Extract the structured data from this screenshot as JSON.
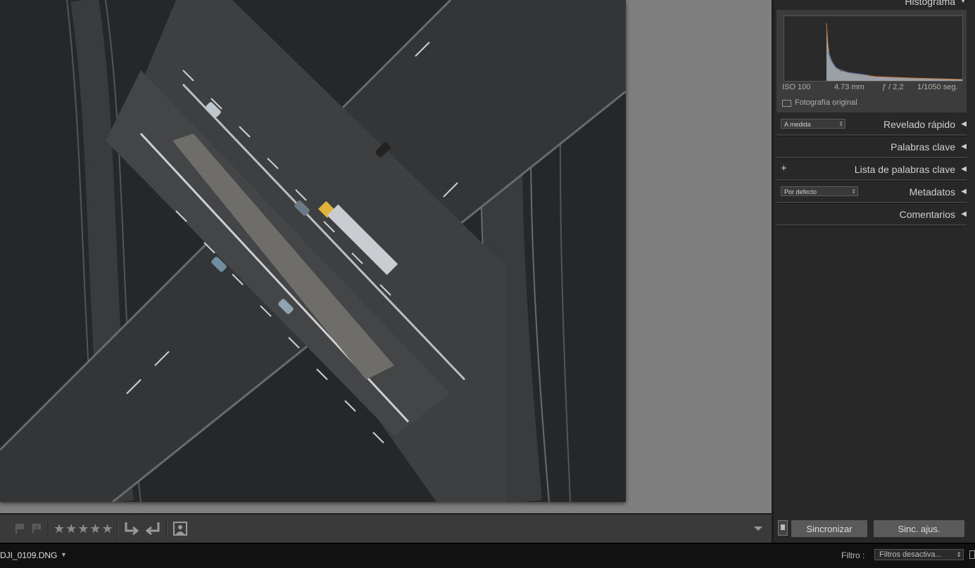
{
  "histogram": {
    "title": "Histograma",
    "iso": "ISO 100",
    "focal": "4.73 mm",
    "aperture": "ƒ / 2,2",
    "shutter": "1/1050 seg.",
    "original_label": "Fotografía original"
  },
  "panels": {
    "quick_develop": {
      "title": "Revelado rápido",
      "preset": "A medida"
    },
    "keywords": {
      "title": "Palabras clave"
    },
    "keyword_list": {
      "title": "Lista de palabras clave",
      "add_symbol": "+"
    },
    "metadata": {
      "title": "Metadatos",
      "preset": "Por defecto"
    },
    "comments": {
      "title": "Comentarios"
    }
  },
  "sync": {
    "sync_label": "Sincronizar",
    "sync_settings_label": "Sinc. ajus."
  },
  "toolbar": {
    "stars": "★★★★★"
  },
  "filmstrip": {
    "filename": "DJI_0109.DNG",
    "filter_label": "Filtro :",
    "filter_value": "Filtros desactiva..."
  },
  "colors": {
    "viewport_bg": "#7f7f7f",
    "panel_bg": "#282828",
    "text": "#cfcfcf"
  }
}
